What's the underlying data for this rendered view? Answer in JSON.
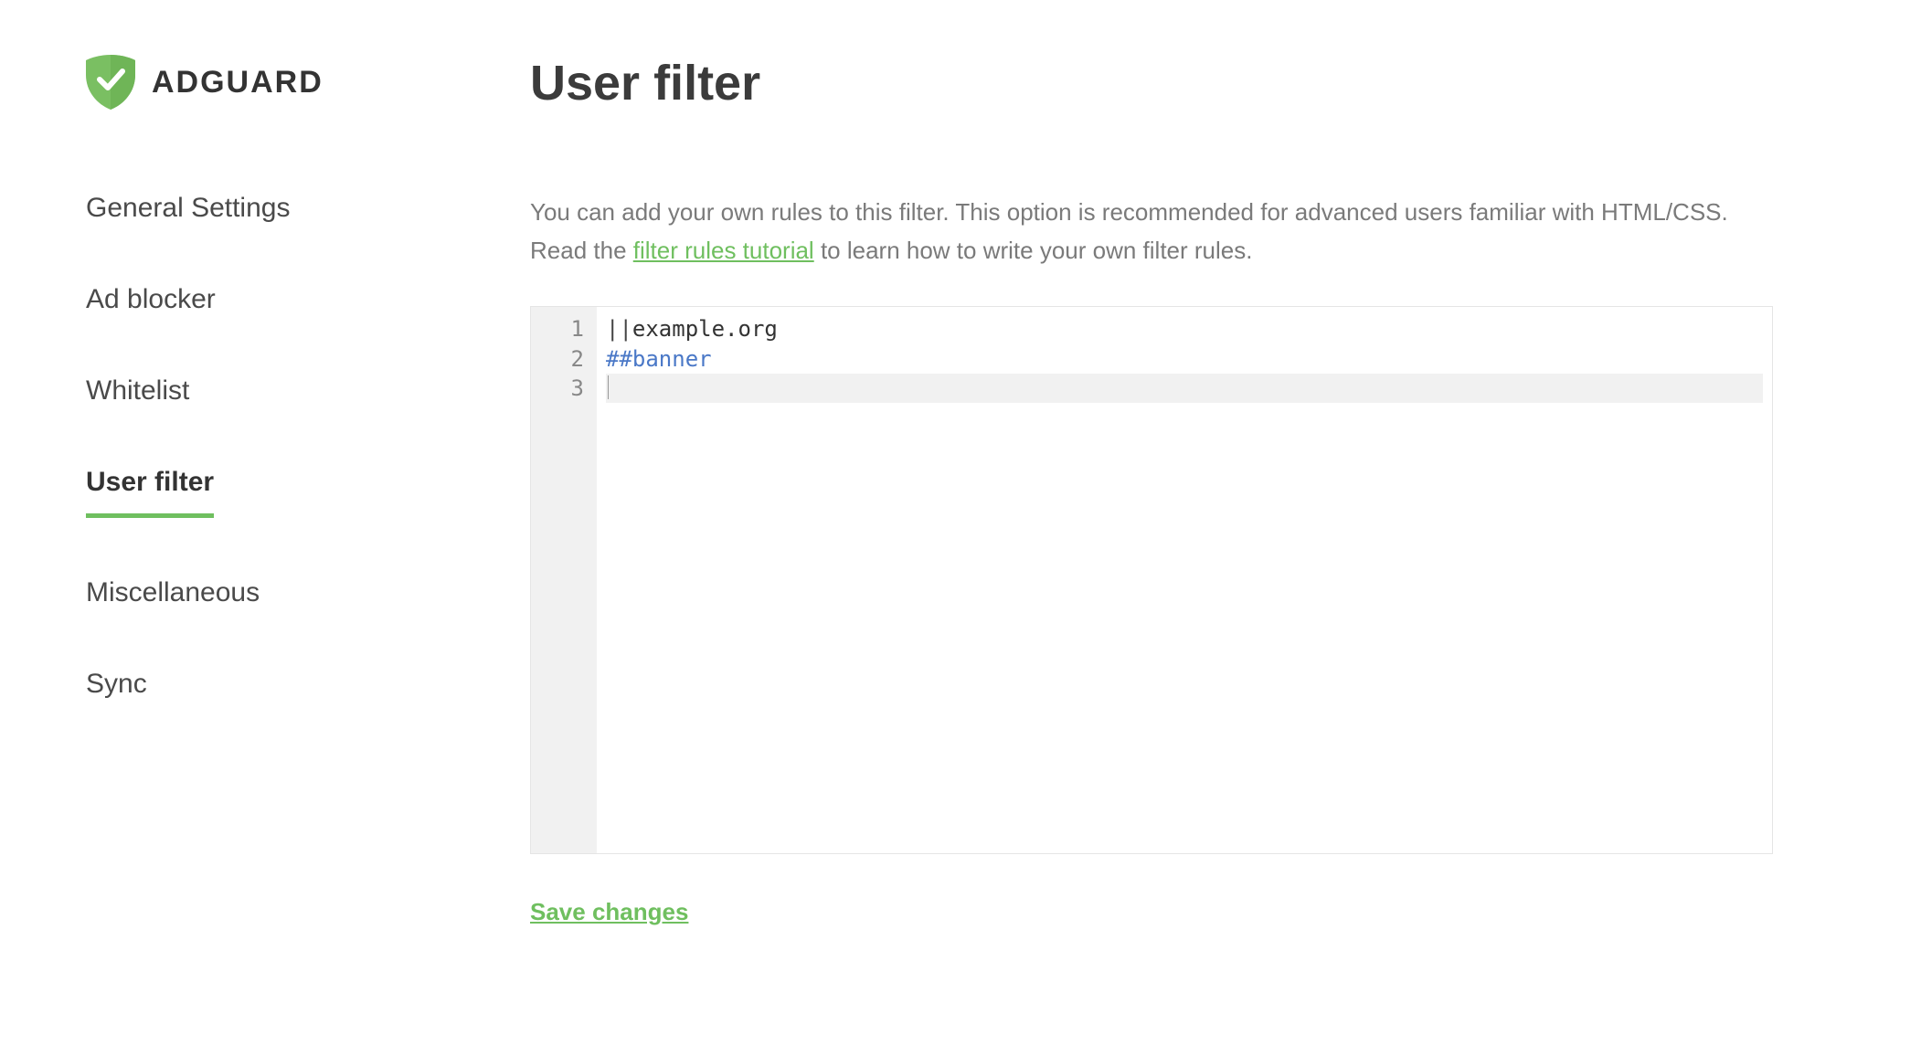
{
  "brand": "ADGUARD",
  "sidebar": {
    "items": [
      {
        "label": "General Settings",
        "active": false
      },
      {
        "label": "Ad blocker",
        "active": false
      },
      {
        "label": "Whitelist",
        "active": false
      },
      {
        "label": "User filter",
        "active": true
      },
      {
        "label": "Miscellaneous",
        "active": false
      },
      {
        "label": "Sync",
        "active": false
      }
    ]
  },
  "page": {
    "title": "User filter",
    "description_pre": "You can add your own rules to this filter. This option is recommended for advanced users familiar with HTML/CSS. Read the ",
    "tutorial_link": "filter rules tutorial",
    "description_post": " to learn how to write your own filter rules.",
    "save_label": "Save changes"
  },
  "editor": {
    "line_numbers": [
      "1",
      "2",
      "3"
    ],
    "lines": [
      {
        "prefix": "||",
        "body": "example.org",
        "css_body": "dom"
      },
      {
        "prefix": "##",
        "body": "banner",
        "css_prefix": "sel",
        "css_body": "sel"
      },
      {
        "prefix": "",
        "body": "",
        "current": true
      }
    ]
  }
}
